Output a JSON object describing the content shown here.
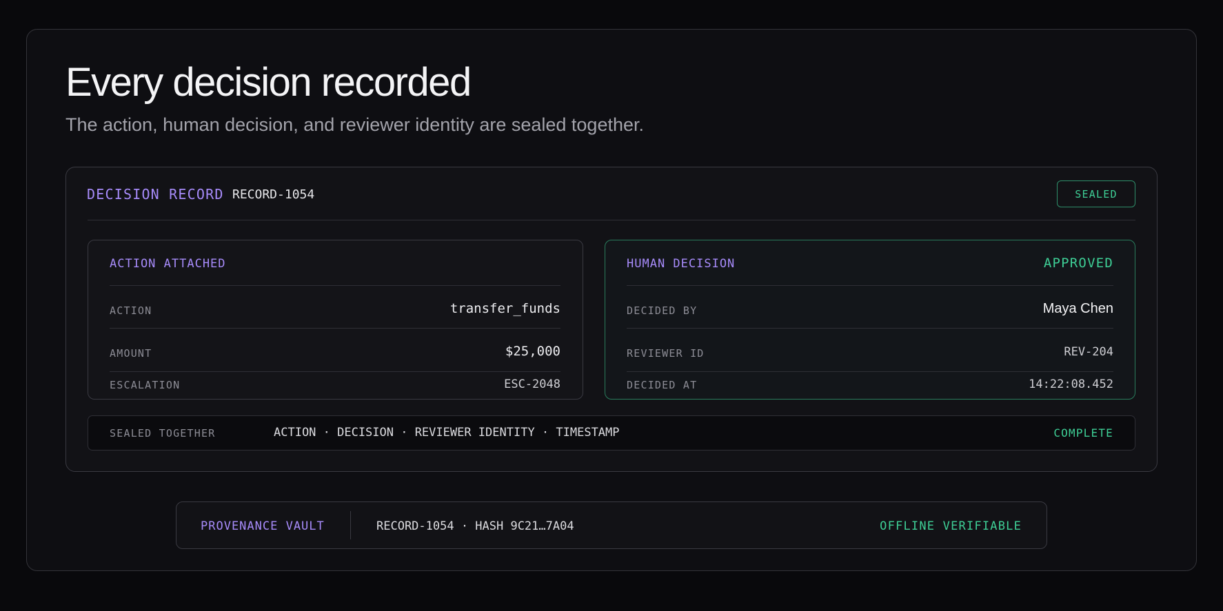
{
  "header": {
    "title": "Every decision recorded",
    "subtitle": "The action, human decision, and reviewer identity are sealed together."
  },
  "record": {
    "label": "DECISION RECORD",
    "id": "RECORD-1054",
    "status_badge": "SEALED"
  },
  "action_panel": {
    "heading": "ACTION ATTACHED",
    "rows": [
      {
        "label": "ACTION",
        "value": "transfer_funds"
      },
      {
        "label": "AMOUNT",
        "value": "$25,000"
      },
      {
        "label": "ESCALATION",
        "value": "ESC-2048"
      }
    ]
  },
  "decision_panel": {
    "heading": "HUMAN DECISION",
    "status": "APPROVED",
    "rows": [
      {
        "label": "DECIDED BY",
        "value": "Maya Chen"
      },
      {
        "label": "REVIEWER ID",
        "value": "REV-204"
      },
      {
        "label": "DECIDED AT",
        "value": "14:22:08.452"
      }
    ]
  },
  "sealed_together": {
    "label": "SEALED TOGETHER",
    "items": "ACTION · DECISION · REVIEWER IDENTITY · TIMESTAMP",
    "status": "COMPLETE"
  },
  "vault": {
    "label": "PROVENANCE VAULT",
    "record": "RECORD-1054 · HASH 9C21…7A04",
    "status": "OFFLINE VERIFIABLE"
  },
  "colors": {
    "background": "#09090c",
    "accent_purple": "#a78bfa",
    "accent_green": "#3ecf96"
  }
}
